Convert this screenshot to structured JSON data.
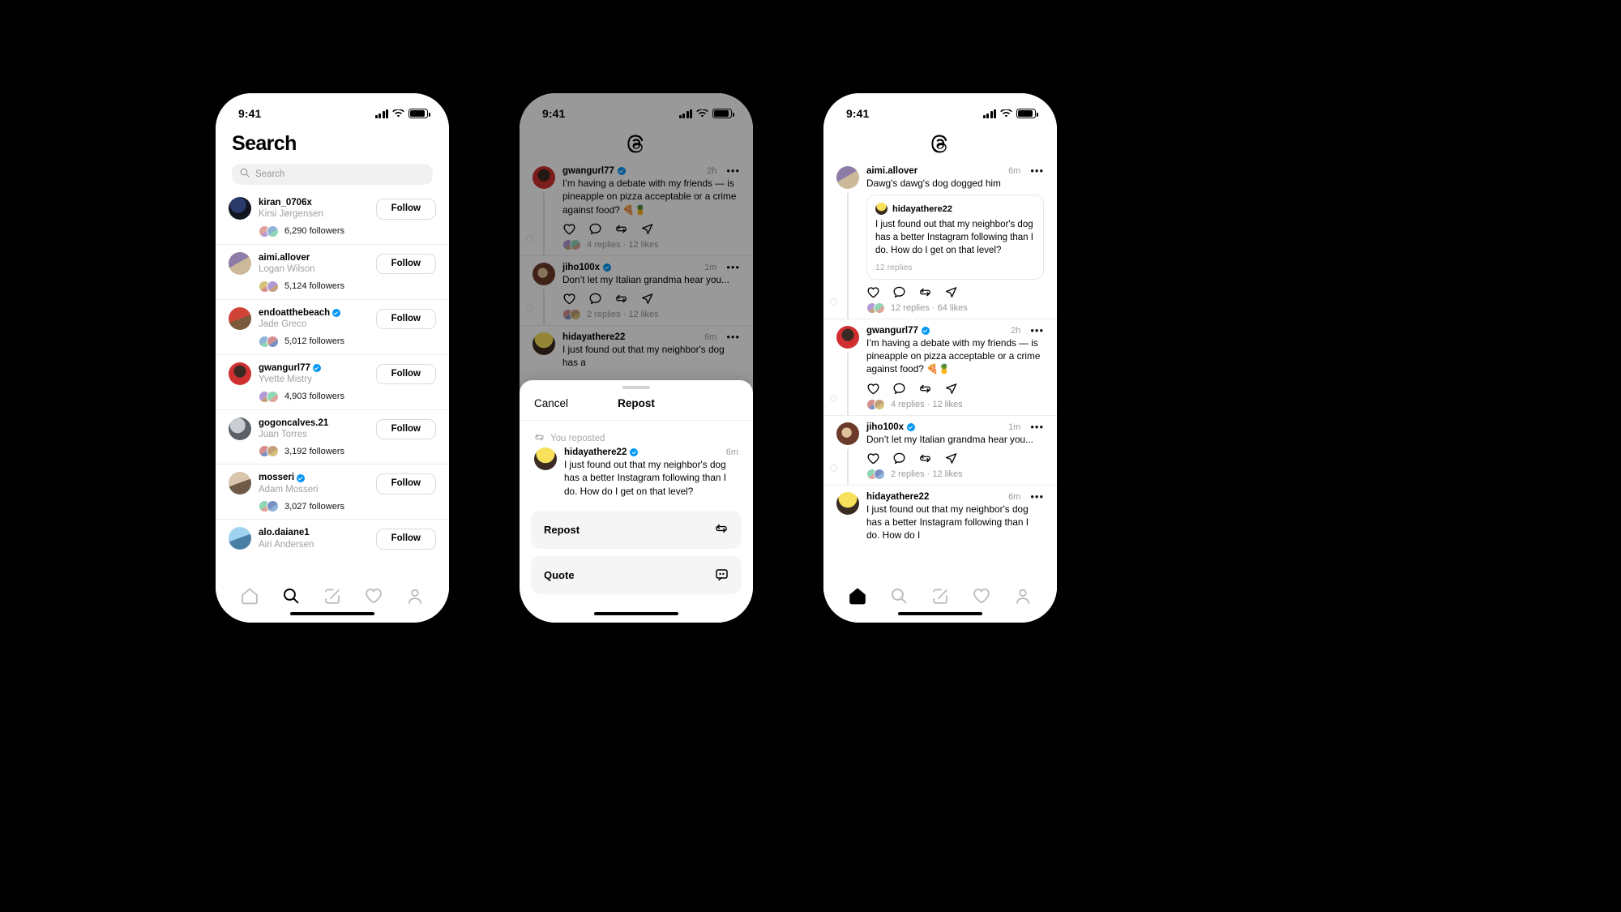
{
  "statusbar": {
    "time": "9:41"
  },
  "phone1": {
    "title": "Search",
    "search": {
      "placeholder": "Search"
    },
    "follow_label": "Follow",
    "users": [
      {
        "username": "kiran_0706x",
        "fullname": "Kirsi Jørgensen",
        "followers": "6,290 followers",
        "verified": false
      },
      {
        "username": "aimi.allover",
        "fullname": "Logan Wilson",
        "followers": "5,124 followers",
        "verified": false
      },
      {
        "username": "endoatthebeach",
        "fullname": "Jade Greco",
        "followers": "5,012 followers",
        "verified": true
      },
      {
        "username": "gwangurl77",
        "fullname": "Yvette Mistry",
        "followers": "4,903 followers",
        "verified": true
      },
      {
        "username": "gogoncalves.21",
        "fullname": "Juan Torres",
        "followers": "3,192 followers",
        "verified": false
      },
      {
        "username": "mosseri",
        "fullname": "Adam Mosseri",
        "followers": "3,027 followers",
        "verified": true
      },
      {
        "username": "alo.daiane1",
        "fullname": "Airi Andersen",
        "followers": "",
        "verified": false
      }
    ],
    "tabs": [
      {
        "name": "home",
        "active": false
      },
      {
        "name": "search",
        "active": true
      },
      {
        "name": "compose",
        "active": false
      },
      {
        "name": "activity",
        "active": false
      },
      {
        "name": "profile",
        "active": false
      }
    ]
  },
  "phone2": {
    "logo": "threads-logo",
    "posts": [
      {
        "username": "gwangurl77",
        "verified": true,
        "time": "2h",
        "text": "I’m having a debate with my friends — is pineapple on pizza acceptable or a crime against food? 🍕🍍",
        "meta": "4 replies · 12 likes"
      },
      {
        "username": "jiho100x",
        "verified": true,
        "time": "1m",
        "text": "Don’t let my Italian grandma hear you...",
        "meta": "2 replies · 12 likes"
      },
      {
        "username": "hidayathere22",
        "verified": false,
        "time": "6m",
        "text": "I just found out that my neighbor's dog has a",
        "meta": ""
      }
    ],
    "sheet": {
      "cancel": "Cancel",
      "title": "Repost",
      "reposted_label": "You reposted",
      "post": {
        "username": "hidayathere22",
        "verified": true,
        "time": "6m",
        "text": "I just found out that my neighbor's dog has a better Instagram following than I do. How do I get on that level?"
      },
      "actions": [
        {
          "label": "Repost",
          "icon": "repost-icon"
        },
        {
          "label": "Quote",
          "icon": "quote-icon"
        }
      ]
    }
  },
  "phone3": {
    "logo": "threads-logo",
    "posts": [
      {
        "username": "aimi.allover",
        "verified": false,
        "time": "6m",
        "text": "Dawg's dawg's dog dogged him",
        "quote": {
          "username": "hidayathere22",
          "text": "I just found out that my neighbor's dog has a better Instagram following than I do. How do I get on that level?",
          "meta": "12 replies"
        },
        "meta": "12 replies · 64 likes"
      },
      {
        "username": "gwangurl77",
        "verified": true,
        "time": "2h",
        "text": "I’m having a debate with my friends — is pineapple on pizza acceptable or a crime against food? 🍕🍍",
        "meta": "4 replies · 12 likes"
      },
      {
        "username": "jiho100x",
        "verified": true,
        "time": "1m",
        "text": "Don’t let my Italian grandma hear you...",
        "meta": "2 replies · 12 likes"
      },
      {
        "username": "hidayathere22",
        "verified": false,
        "time": "6m",
        "text": "I just found out that my neighbor's dog has a better Instagram following than I do. How do I",
        "meta": ""
      }
    ],
    "tabs": [
      {
        "name": "home",
        "active": true
      },
      {
        "name": "search",
        "active": false
      },
      {
        "name": "compose",
        "active": false
      },
      {
        "name": "activity",
        "active": false
      },
      {
        "name": "profile",
        "active": false
      }
    ]
  },
  "colors": {
    "verified_blue": "#0095f6",
    "background": "#000000",
    "surface": "#ffffff",
    "muted_text": "#999999"
  }
}
